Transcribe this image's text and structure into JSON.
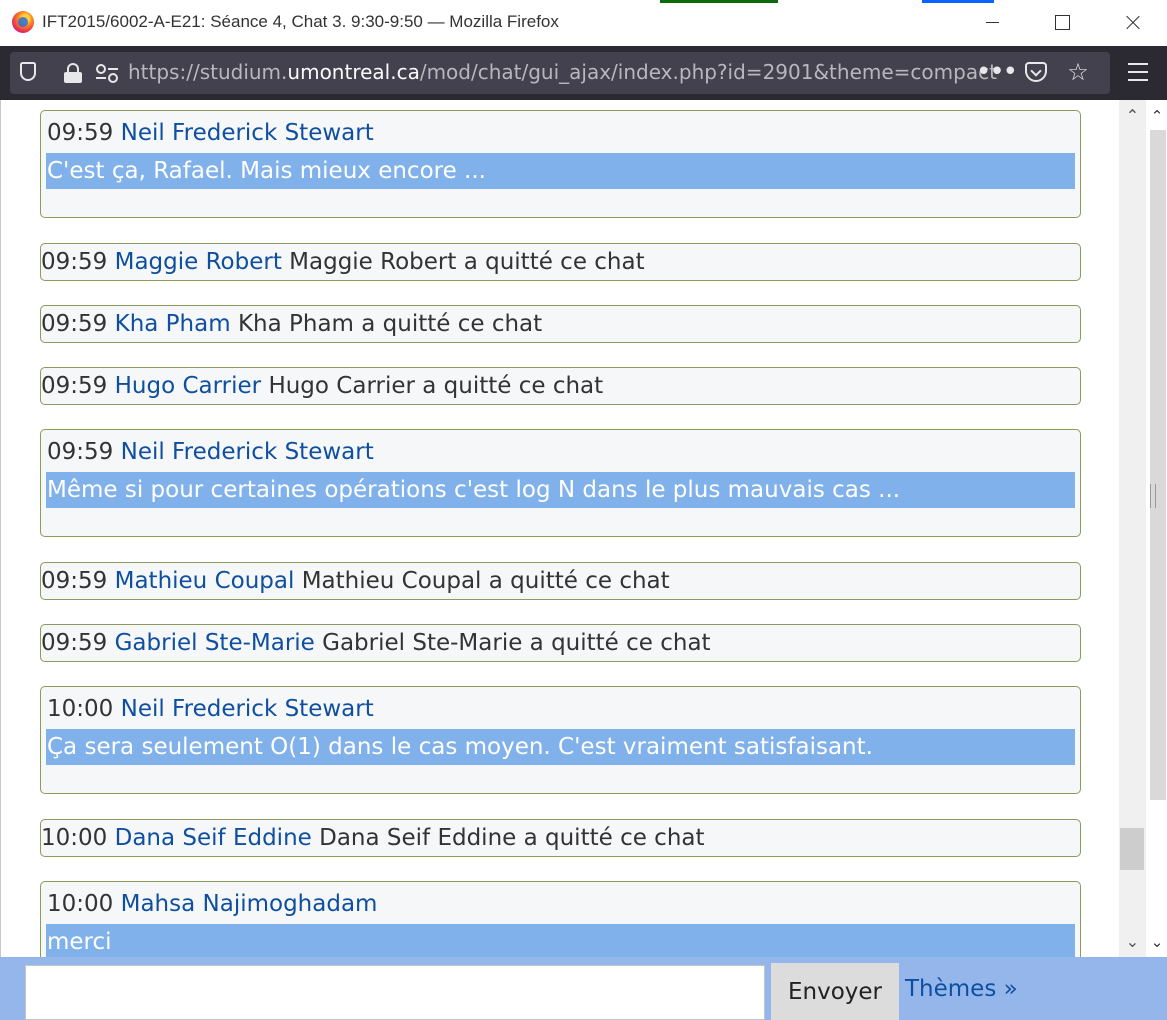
{
  "window": {
    "title": "IFT2015/6002-A-E21: Séance 4, Chat 3. 9:30-9:50 — Mozilla Firefox"
  },
  "toolbar": {
    "url_prefix": "https://studium.",
    "url_host": "umontreal.ca",
    "url_suffix": "/mod/chat/gui_ajax/index.php?id=2901&theme=compact",
    "more_glyph": "•••",
    "star_glyph": "☆"
  },
  "scroll": {
    "up_glyph": "⌃",
    "down_glyph": "⌄"
  },
  "messages": [
    {
      "time": "09:59",
      "name": "Neil Frederick Stewart",
      "text": "C'est ça, Rafael. Mais mieux encore ..."
    },
    {
      "time": "09:59",
      "name": "Maggie Robert",
      "text": "Maggie Robert a quitté ce chat"
    },
    {
      "time": "09:59",
      "name": "Kha Pham",
      "text": "Kha Pham a quitté ce chat"
    },
    {
      "time": "09:59",
      "name": "Hugo Carrier",
      "text": "Hugo Carrier a quitté ce chat"
    },
    {
      "time": "09:59",
      "name": "Neil Frederick Stewart",
      "text": "Même si pour certaines opérations c'est log N dans le plus mauvais cas ..."
    },
    {
      "time": "09:59",
      "name": "Mathieu Coupal",
      "text": "Mathieu Coupal a quitté ce chat"
    },
    {
      "time": "09:59",
      "name": "Gabriel Ste-Marie",
      "text": "Gabriel Ste-Marie a quitté ce chat"
    },
    {
      "time": "10:00",
      "name": "Neil Frederick Stewart",
      "text": "Ça sera seulement O(1) dans le cas moyen. C'est vraiment satisfaisant."
    },
    {
      "time": "10:00",
      "name": "Dana Seif Eddine",
      "text": "Dana Seif Eddine a quitté ce chat"
    },
    {
      "time": "10:00",
      "name": "Mahsa Najimoghadam",
      "text": "merci"
    }
  ],
  "input": {
    "value": "",
    "send_label": "Envoyer",
    "themes_label": "Thèmes »"
  },
  "colors": {
    "highlight": "#81b1ea",
    "link": "#0f4fa0",
    "input_bar": "#94b6ea"
  }
}
